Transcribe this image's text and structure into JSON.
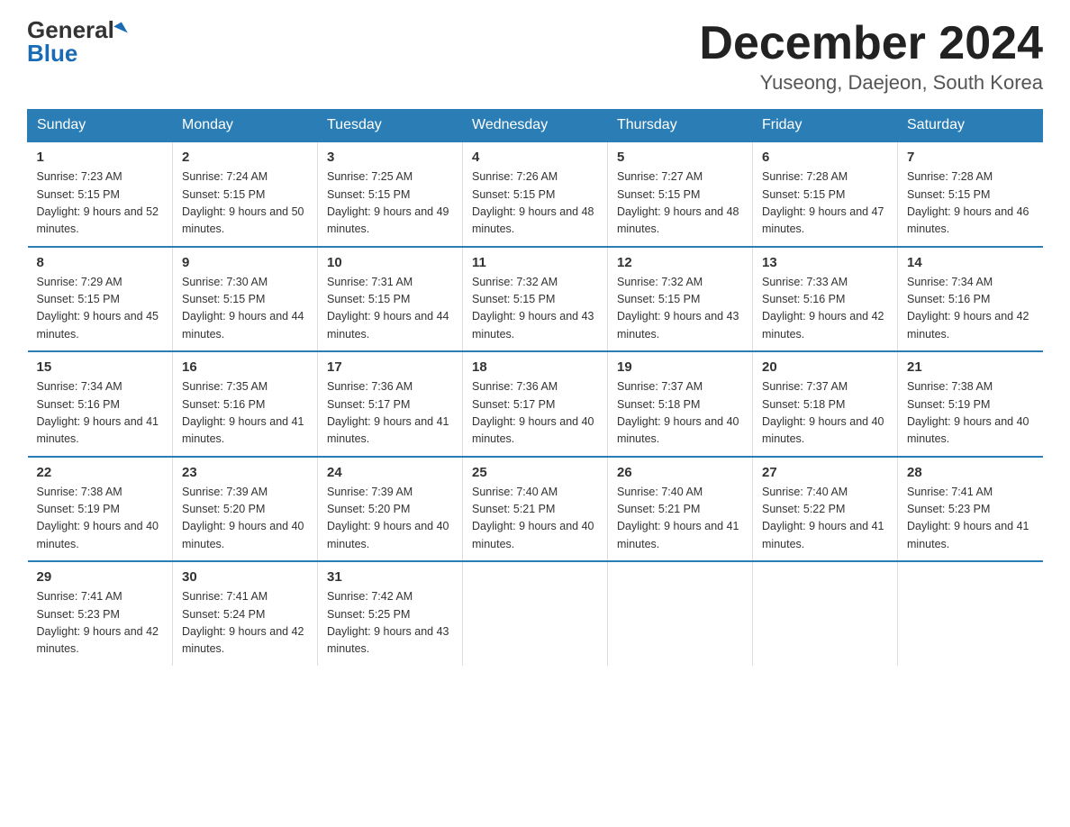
{
  "header": {
    "logo_general": "General",
    "logo_blue": "Blue",
    "month_title": "December 2024",
    "location": "Yuseong, Daejeon, South Korea"
  },
  "days_of_week": [
    "Sunday",
    "Monday",
    "Tuesday",
    "Wednesday",
    "Thursday",
    "Friday",
    "Saturday"
  ],
  "weeks": [
    [
      {
        "day": "1",
        "sunrise": "7:23 AM",
        "sunset": "5:15 PM",
        "daylight": "9 hours and 52 minutes."
      },
      {
        "day": "2",
        "sunrise": "7:24 AM",
        "sunset": "5:15 PM",
        "daylight": "9 hours and 50 minutes."
      },
      {
        "day": "3",
        "sunrise": "7:25 AM",
        "sunset": "5:15 PM",
        "daylight": "9 hours and 49 minutes."
      },
      {
        "day": "4",
        "sunrise": "7:26 AM",
        "sunset": "5:15 PM",
        "daylight": "9 hours and 48 minutes."
      },
      {
        "day": "5",
        "sunrise": "7:27 AM",
        "sunset": "5:15 PM",
        "daylight": "9 hours and 48 minutes."
      },
      {
        "day": "6",
        "sunrise": "7:28 AM",
        "sunset": "5:15 PM",
        "daylight": "9 hours and 47 minutes."
      },
      {
        "day": "7",
        "sunrise": "7:28 AM",
        "sunset": "5:15 PM",
        "daylight": "9 hours and 46 minutes."
      }
    ],
    [
      {
        "day": "8",
        "sunrise": "7:29 AM",
        "sunset": "5:15 PM",
        "daylight": "9 hours and 45 minutes."
      },
      {
        "day": "9",
        "sunrise": "7:30 AM",
        "sunset": "5:15 PM",
        "daylight": "9 hours and 44 minutes."
      },
      {
        "day": "10",
        "sunrise": "7:31 AM",
        "sunset": "5:15 PM",
        "daylight": "9 hours and 44 minutes."
      },
      {
        "day": "11",
        "sunrise": "7:32 AM",
        "sunset": "5:15 PM",
        "daylight": "9 hours and 43 minutes."
      },
      {
        "day": "12",
        "sunrise": "7:32 AM",
        "sunset": "5:15 PM",
        "daylight": "9 hours and 43 minutes."
      },
      {
        "day": "13",
        "sunrise": "7:33 AM",
        "sunset": "5:16 PM",
        "daylight": "9 hours and 42 minutes."
      },
      {
        "day": "14",
        "sunrise": "7:34 AM",
        "sunset": "5:16 PM",
        "daylight": "9 hours and 42 minutes."
      }
    ],
    [
      {
        "day": "15",
        "sunrise": "7:34 AM",
        "sunset": "5:16 PM",
        "daylight": "9 hours and 41 minutes."
      },
      {
        "day": "16",
        "sunrise": "7:35 AM",
        "sunset": "5:16 PM",
        "daylight": "9 hours and 41 minutes."
      },
      {
        "day": "17",
        "sunrise": "7:36 AM",
        "sunset": "5:17 PM",
        "daylight": "9 hours and 41 minutes."
      },
      {
        "day": "18",
        "sunrise": "7:36 AM",
        "sunset": "5:17 PM",
        "daylight": "9 hours and 40 minutes."
      },
      {
        "day": "19",
        "sunrise": "7:37 AM",
        "sunset": "5:18 PM",
        "daylight": "9 hours and 40 minutes."
      },
      {
        "day": "20",
        "sunrise": "7:37 AM",
        "sunset": "5:18 PM",
        "daylight": "9 hours and 40 minutes."
      },
      {
        "day": "21",
        "sunrise": "7:38 AM",
        "sunset": "5:19 PM",
        "daylight": "9 hours and 40 minutes."
      }
    ],
    [
      {
        "day": "22",
        "sunrise": "7:38 AM",
        "sunset": "5:19 PM",
        "daylight": "9 hours and 40 minutes."
      },
      {
        "day": "23",
        "sunrise": "7:39 AM",
        "sunset": "5:20 PM",
        "daylight": "9 hours and 40 minutes."
      },
      {
        "day": "24",
        "sunrise": "7:39 AM",
        "sunset": "5:20 PM",
        "daylight": "9 hours and 40 minutes."
      },
      {
        "day": "25",
        "sunrise": "7:40 AM",
        "sunset": "5:21 PM",
        "daylight": "9 hours and 40 minutes."
      },
      {
        "day": "26",
        "sunrise": "7:40 AM",
        "sunset": "5:21 PM",
        "daylight": "9 hours and 41 minutes."
      },
      {
        "day": "27",
        "sunrise": "7:40 AM",
        "sunset": "5:22 PM",
        "daylight": "9 hours and 41 minutes."
      },
      {
        "day": "28",
        "sunrise": "7:41 AM",
        "sunset": "5:23 PM",
        "daylight": "9 hours and 41 minutes."
      }
    ],
    [
      {
        "day": "29",
        "sunrise": "7:41 AM",
        "sunset": "5:23 PM",
        "daylight": "9 hours and 42 minutes."
      },
      {
        "day": "30",
        "sunrise": "7:41 AM",
        "sunset": "5:24 PM",
        "daylight": "9 hours and 42 minutes."
      },
      {
        "day": "31",
        "sunrise": "7:42 AM",
        "sunset": "5:25 PM",
        "daylight": "9 hours and 43 minutes."
      },
      null,
      null,
      null,
      null
    ]
  ]
}
